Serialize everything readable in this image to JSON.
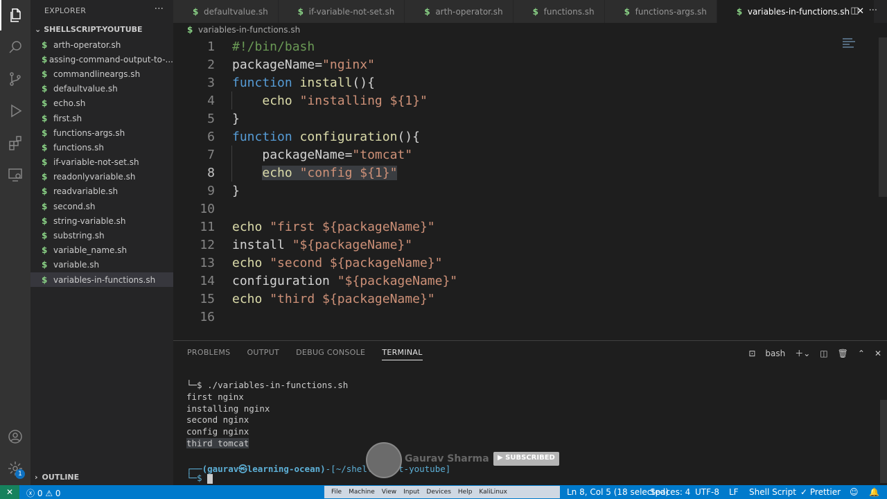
{
  "sidebar": {
    "title": "EXPLORER",
    "more": "···",
    "folder": "SHELLSCRIPT-YOUTUBE",
    "files": [
      "arth-operator.sh",
      "assing-command-output-to-...",
      "commandlineargs.sh",
      "defaultvalue.sh",
      "echo.sh",
      "first.sh",
      "functions-args.sh",
      "functions.sh",
      "if-variable-not-set.sh",
      "readonlyvariable.sh",
      "readvariable.sh",
      "second.sh",
      "string-variable.sh",
      "substring.sh",
      "variable_name.sh",
      "variable.sh",
      "variables-in-functions.sh"
    ],
    "selected_file": "variables-in-functions.sh",
    "outline": "OUTLINE",
    "badge": "1"
  },
  "tabs": [
    {
      "label": "defaultvalue.sh"
    },
    {
      "label": "if-variable-not-set.sh"
    },
    {
      "label": "arth-operator.sh"
    },
    {
      "label": "functions.sh"
    },
    {
      "label": "functions-args.sh"
    },
    {
      "label": "variables-in-functions.sh",
      "active": true
    }
  ],
  "breadcrumb": "variables-in-functions.sh",
  "editor": {
    "line_numbers": [
      "1",
      "2",
      "3",
      "4",
      "5",
      "6",
      "7",
      "8",
      "9",
      "10",
      "11",
      "12",
      "13",
      "14",
      "15",
      "16"
    ],
    "current_line": "8"
  },
  "panel": {
    "tabs": [
      "PROBLEMS",
      "OUTPUT",
      "DEBUG CONSOLE",
      "TERMINAL"
    ],
    "active_tab": "TERMINAL",
    "shell": "bash",
    "terminal_lines": [
      "└─$ ./variables-in-functions.sh",
      "first nginx",
      "installing nginx",
      "second nginx",
      "config nginx",
      "third tomcat"
    ],
    "prompt_user": "(gaurav㉿learning-ocean)",
    "prompt_path": "-[~/shellscript-youtube]",
    "prompt_symbol": "└─$"
  },
  "overlay": {
    "name": "Gaurav Sharma",
    "subscribe": "SUBSCRIBED"
  },
  "status": {
    "errors": "0",
    "warnings": "0",
    "cursor": "Ln 8, Col 5 (18 selected)",
    "spaces": "Spaces: 4",
    "encoding": "UTF-8",
    "eol": "LF",
    "language": "Shell Script",
    "formatter": "Prettier",
    "vbox_menu": [
      "File",
      "Machine",
      "View",
      "Input",
      "Devices",
      "Help",
      "KaliLinux"
    ]
  },
  "colors": {
    "accent": "#007acc",
    "keyword": "#569cd6",
    "function": "#dcdcaa",
    "string": "#ce9178",
    "variable": "#9cdcfe"
  }
}
